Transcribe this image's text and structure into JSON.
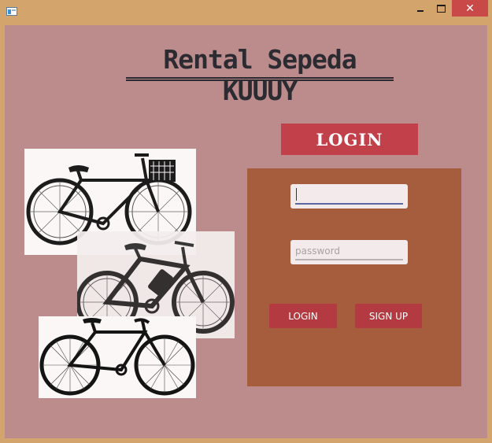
{
  "window": {
    "minimize_label": "",
    "close_label": "✕"
  },
  "page": {
    "title": "Rental Sepeda KUUUY"
  },
  "login": {
    "header": "LOGIN",
    "username_value": "",
    "username_placeholder": "",
    "password_placeholder": "password",
    "login_button": "LOGIN",
    "signup_button": "SIGN UP"
  },
  "images": [
    {
      "name": "city-bike-with-basket-photo",
      "icon": "bicycle-icon"
    },
    {
      "name": "electric-bike-photo",
      "icon": "bicycle-icon"
    },
    {
      "name": "road-bike-photo",
      "icon": "bicycle-icon"
    }
  ],
  "colors": {
    "window_frame": "#d3a46c",
    "background": "#bc8c8c",
    "panel": "#a55d3e",
    "accent": "#c2404a",
    "button": "#b33a40",
    "close_button": "#c94848"
  }
}
